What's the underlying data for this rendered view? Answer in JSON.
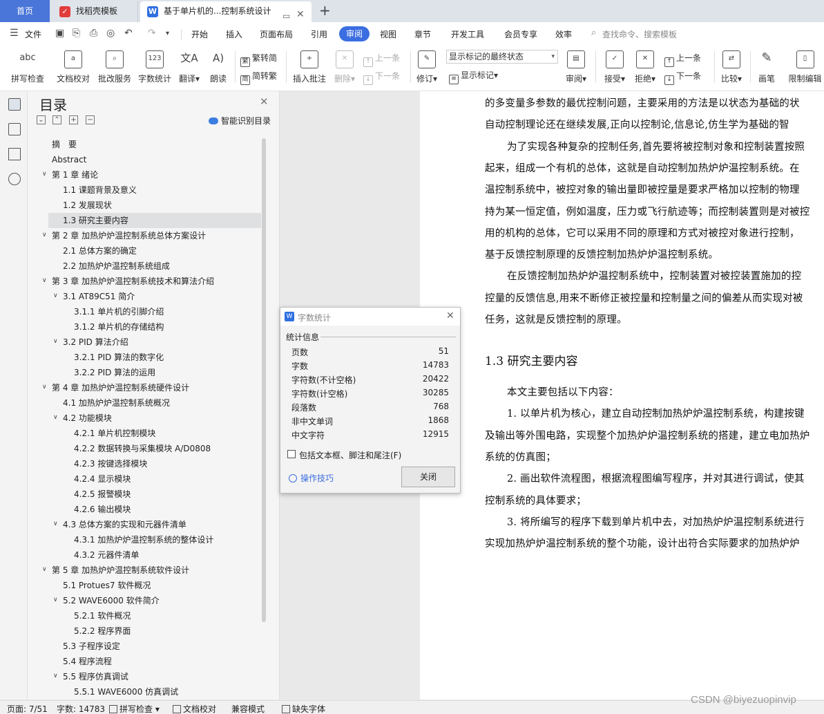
{
  "tabs": {
    "home": "首页",
    "templates": "找稻壳模板",
    "document": "基于单片机的...控制系统设计"
  },
  "menu": {
    "file": "文件",
    "items": [
      "开始",
      "插入",
      "页面布局",
      "引用",
      "审阅",
      "视图",
      "章节",
      "开发工具",
      "会员专享",
      "效率"
    ],
    "active": "审阅",
    "search": "查找命令、搜索模板"
  },
  "ribbon": {
    "spell_check": "拼写检查",
    "doc_proof": "文档校对",
    "annotate_service": "批改服务",
    "word_count": "字数统计",
    "translate": "翻译",
    "read_aloud": "朗读",
    "trad_to_simp": "繁转简",
    "simp_to_trad": "简转繁",
    "insert_comment": "插入批注",
    "delete": "删除",
    "prev_comment": "上一条",
    "next_comment": "下一条",
    "revise": "修订",
    "markup_select": "显示标记的最终状态",
    "show_markup": "显示标记",
    "review": "审阅",
    "accept": "接受",
    "reject": "拒绝",
    "prev_change": "上一条",
    "next_change": "下一条",
    "compare": "比较",
    "pen": "画笔",
    "restrict_edit": "限制编辑"
  },
  "toc": {
    "title": "目录",
    "smart": "智能识别目录",
    "items": [
      {
        "text": "摘　要",
        "level": 0,
        "chev": false
      },
      {
        "text": "Abstract",
        "level": 0,
        "chev": false
      },
      {
        "text": "第 1 章  绪论",
        "level": 0,
        "chev": true
      },
      {
        "text": "1.1 课题背景及意义",
        "level": 1,
        "chev": false
      },
      {
        "text": "1.2 发展现状",
        "level": 1,
        "chev": false
      },
      {
        "text": "1.3 研究主要内容",
        "level": 1,
        "chev": false,
        "active": true
      },
      {
        "text": "第 2 章  加热炉炉温控制系统总体方案设计",
        "level": 0,
        "chev": true
      },
      {
        "text": "2.1 总体方案的确定",
        "level": 1,
        "chev": false
      },
      {
        "text": "2.2 加热炉炉温控制系统组成",
        "level": 1,
        "chev": false
      },
      {
        "text": "第 3 章  加热炉炉温控制系统技术和算法介绍",
        "level": 0,
        "chev": true
      },
      {
        "text": "3.1 AT89C51 简介",
        "level": 1,
        "chev": true
      },
      {
        "text": "3.1.1 单片机的引脚介绍",
        "level": 2,
        "chev": false
      },
      {
        "text": "3.1.2 单片机的存储结构",
        "level": 2,
        "chev": false
      },
      {
        "text": "3.2 PID 算法介绍",
        "level": 1,
        "chev": true
      },
      {
        "text": "3.2.1 PID 算法的数字化",
        "level": 2,
        "chev": false
      },
      {
        "text": "3.2.2 PID 算法的运用",
        "level": 2,
        "chev": false
      },
      {
        "text": "第 4 章  加热炉炉温控制系统硬件设计",
        "level": 0,
        "chev": true
      },
      {
        "text": "4.1 加热炉炉温控制系统概况",
        "level": 1,
        "chev": false
      },
      {
        "text": "4.2 功能模块",
        "level": 1,
        "chev": true
      },
      {
        "text": "4.2.1 单片机控制模块",
        "level": 2,
        "chev": false
      },
      {
        "text": "4.2.2 数据转换与采集模块 A/D0808",
        "level": 2,
        "chev": false
      },
      {
        "text": "4.2.3 按键选择模块",
        "level": 2,
        "chev": false
      },
      {
        "text": "4.2.4 显示模块",
        "level": 2,
        "chev": false
      },
      {
        "text": "4.2.5 报警模块",
        "level": 2,
        "chev": false
      },
      {
        "text": "4.2.6 输出模块",
        "level": 2,
        "chev": false
      },
      {
        "text": "4.3 总体方案的实现和元器件清单",
        "level": 1,
        "chev": true
      },
      {
        "text": "4.3.1 加热炉炉温控制系统的整体设计",
        "level": 2,
        "chev": false
      },
      {
        "text": "4.3.2 元器件清单",
        "level": 2,
        "chev": false
      },
      {
        "text": "第 5 章  加热炉炉温控制系统软件设计",
        "level": 0,
        "chev": true
      },
      {
        "text": "5.1 Protues7 软件概况",
        "level": 1,
        "chev": false
      },
      {
        "text": "5.2 WAVE6000 软件简介",
        "level": 1,
        "chev": true
      },
      {
        "text": "5.2.1 软件概况",
        "level": 2,
        "chev": false
      },
      {
        "text": "5.2.2 程序界面",
        "level": 2,
        "chev": false
      },
      {
        "text": "5.3 子程序设定",
        "level": 1,
        "chev": false
      },
      {
        "text": "5.4 程序流程",
        "level": 1,
        "chev": false
      },
      {
        "text": "5.5 程序仿真调试",
        "level": 1,
        "chev": true
      },
      {
        "text": "5.5.1 WAVE6000 仿真调试",
        "level": 2,
        "chev": false
      }
    ]
  },
  "document": {
    "lines": [
      {
        "text": "的多变量多参数的最优控制问题，主要采用的方法是以状态为基础的状",
        "indent": false
      },
      {
        "text": "自动控制理论还在继续发展,正向以控制论,信息论,仿生学为基础的智",
        "indent": false
      },
      {
        "text": "为了实现各种复杂的控制任务,首先要将被控制对象和控制装置按照",
        "indent": true
      },
      {
        "text": "起来，组成一个有机的总体，这就是自动控制加热炉炉温控制系统。在",
        "indent": false
      },
      {
        "text": "温控制系统中，被控对象的输出量即被控量是要求严格加以控制的物理",
        "indent": false
      },
      {
        "text": "持为某一恒定值，例如温度，压力或飞行航迹等；而控制装置则是对被控",
        "indent": false
      },
      {
        "text": "用的机构的总体，它可以采用不同的原理和方式对被控对象进行控制，",
        "indent": false
      },
      {
        "text": "基于反馈控制原理的反馈控制加热炉炉温控制系统。",
        "indent": false
      },
      {
        "text": "在反馈控制加热炉炉温控制系统中，控制装置对被控装置施加的控",
        "indent": true
      },
      {
        "text": "控量的反馈信息,用来不断修正被控量和控制量之间的偏差从而实现对被",
        "indent": false
      },
      {
        "text": "任务，这就是反馈控制的原理。",
        "indent": false
      }
    ],
    "heading": "1.3 研究主要内容",
    "lines2": [
      {
        "text": "本文主要包括以下内容：",
        "indent": true
      },
      {
        "text": "1.  以单片机为核心，建立自动控制加热炉炉温控制系统，构建按键",
        "indent": true
      },
      {
        "text": "及输出等外围电路，实现整个加热炉炉温控制系统的搭建，建立电加热炉",
        "indent": false
      },
      {
        "text": "系统的仿真图；",
        "indent": false
      },
      {
        "text": "2.  画出软件流程图，根据流程图编写程序，并对其进行调试，使其",
        "indent": true
      },
      {
        "text": "控制系统的具体要求；",
        "indent": false
      },
      {
        "text": "3.  将所编写的程序下载到单片机中去，对加热炉炉温控制系统进行",
        "indent": true
      },
      {
        "text": "实现加热炉炉温控制系统的整个功能，设计出符合实际要求的加热炉炉",
        "indent": false
      }
    ]
  },
  "dialog": {
    "title": "字数统计",
    "section": "统计信息",
    "stats": [
      {
        "label": "页数",
        "value": "51"
      },
      {
        "label": "字数",
        "value": "14783"
      },
      {
        "label": "字符数(不计空格)",
        "value": "20422"
      },
      {
        "label": "字符数(计空格)",
        "value": "30285"
      },
      {
        "label": "段落数",
        "value": "768"
      },
      {
        "label": "非中文单词",
        "value": "1868"
      },
      {
        "label": "中文字符",
        "value": "12915"
      }
    ],
    "checkbox": "包括文本框、脚注和尾注(F)",
    "tips": "操作技巧",
    "close": "关闭"
  },
  "status": {
    "page": "页面: 7/51",
    "words": "字数: 14783",
    "spell": "拼写检查",
    "proof": "文档校对",
    "compat": "兼容模式",
    "missing_font": "缺失字体"
  },
  "watermark": "CSDN @biyezuopinvip"
}
